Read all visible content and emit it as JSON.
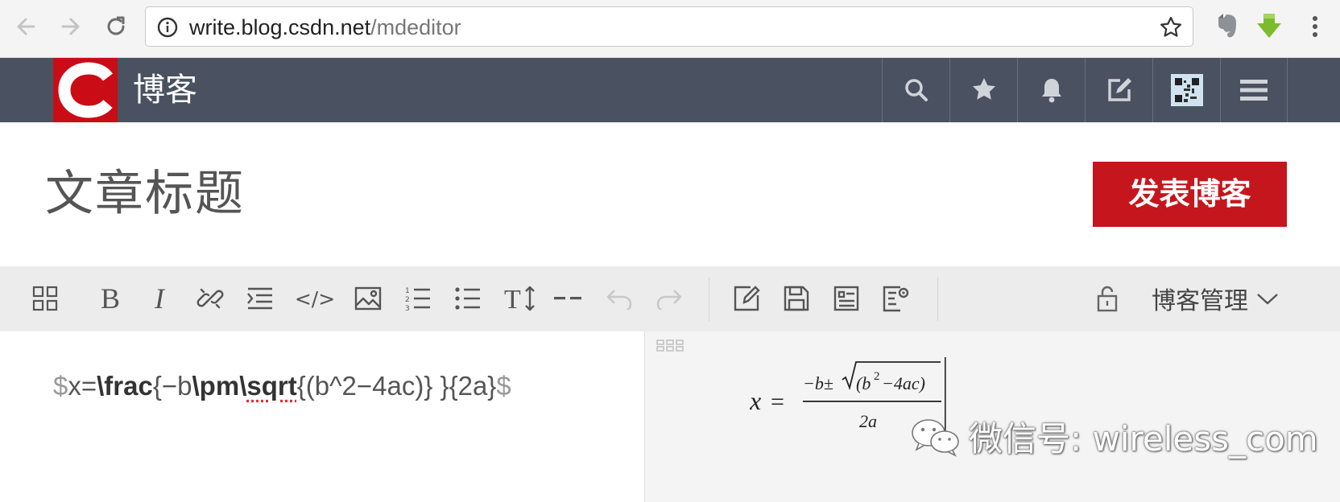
{
  "browser": {
    "url_host": "write.blog.csdn.net",
    "url_path": "/mdeditor",
    "icons": [
      "back-icon",
      "forward-icon",
      "reload-icon",
      "info-icon",
      "bookmark-star-icon",
      "evernote-icon",
      "download-arrow-icon",
      "menu-dots-icon"
    ]
  },
  "header": {
    "logo_letter": "C",
    "site_title": "博客",
    "icons": [
      "search-icon",
      "star-icon",
      "bell-icon",
      "edit-icon",
      "qr-avatar",
      "hamburger-icon"
    ],
    "brand_color": "#ca0c16",
    "bg_color": "#4a5261"
  },
  "editor": {
    "title_placeholder": "文章标题",
    "publish_label": "发表博客",
    "publish_color": "#c5161d"
  },
  "toolbar": {
    "icons": [
      "grid-icon",
      "bold-icon",
      "italic-icon",
      "link-icon",
      "indent-icon",
      "code-icon",
      "image-icon",
      "ordered-list-icon",
      "unordered-list-icon",
      "heading-icon",
      "hr-icon",
      "undo-icon",
      "redo-icon",
      "edit-draft-icon",
      "save-icon",
      "summary-icon",
      "settings-icon",
      "lock-icon"
    ],
    "bold_glyph": "B",
    "italic_glyph": "I",
    "code_glyph": "</>",
    "heading_glyph": "TI",
    "hr_glyph": "--",
    "blog_manage": "博客管理"
  },
  "source": {
    "dollar_open": "$",
    "part1": "x=",
    "frac": "\\frac",
    "part2": "{−b",
    "pm": "\\pm",
    "sqrt_bs": "\\",
    "sqrt": "sqrt",
    "part3": "{(b^2−4ac)} }{2a}",
    "dollar_close": "$"
  },
  "preview": {
    "lhs": "x",
    "eq": "=",
    "numer_prefix": "−b±",
    "radicand_open": "(b",
    "exp": "2",
    "radicand_rest": "−4ac)",
    "denominator": "2a"
  },
  "watermark": {
    "text": "微信号: wireless_com"
  }
}
